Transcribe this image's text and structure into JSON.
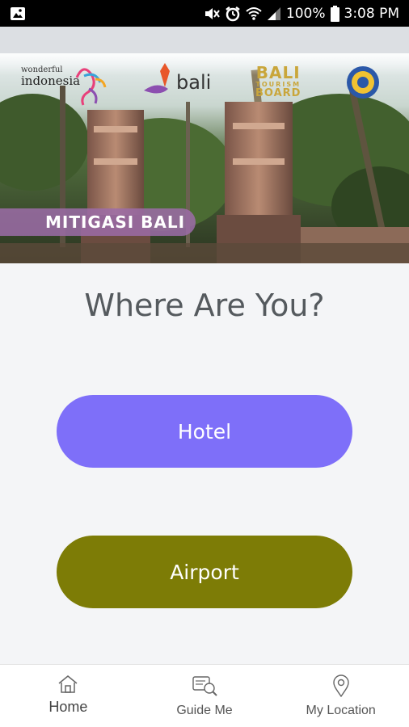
{
  "status_bar": {
    "battery": "100%",
    "time": "3:08 PM",
    "icons": [
      "image-notification-icon",
      "mute-icon",
      "alarm-icon",
      "wifi-icon",
      "signal-icon",
      "battery-icon"
    ]
  },
  "banner": {
    "logo_wonderful": "wonderful",
    "logo_indonesia": "indonesia",
    "logo_bali": "bali",
    "tourism_board_line1": "BALI",
    "tourism_board_line2": "TOURISM",
    "tourism_board_line3": "BOARD",
    "label": "MITIGASI BALI"
  },
  "main": {
    "question": "Where Are You?",
    "options": [
      {
        "label": "Hotel",
        "color": "#7e6ff9"
      },
      {
        "label": "Airport",
        "color": "#7d7c06"
      }
    ]
  },
  "bottom_nav": {
    "items": [
      {
        "label": "Home",
        "icon": "home-icon"
      },
      {
        "label": "Guide Me",
        "icon": "guide-icon"
      },
      {
        "label": "My Location",
        "icon": "location-pin-icon"
      }
    ]
  },
  "colors": {
    "background": "#f4f5f7",
    "hotel": "#7e6ff9",
    "airport": "#7d7c06",
    "banner_label": "#9c6ca8"
  }
}
